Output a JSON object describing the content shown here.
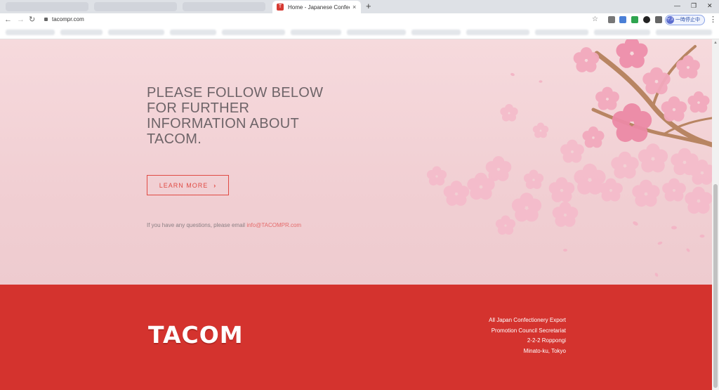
{
  "browser": {
    "active_tab_title": "Home - Japanese Confectionary",
    "tab_close": "×",
    "new_tab": "+",
    "url": "tacompr.com",
    "profile_label": "一時停止中",
    "profile_avatar": "ゲスト"
  },
  "hero": {
    "headline_lines": [
      "PLEASE FOLLOW BELOW",
      "FOR FURTHER",
      "INFORMATION ABOUT",
      "TACOM."
    ],
    "learn_more_label": "LEARN MORE",
    "learn_more_chevron": "›",
    "contact_text": "If you have any questions, please email ",
    "contact_email": "info@TACOMPR.com"
  },
  "footer": {
    "logo_text": "TACOM",
    "address_lines": [
      "All Japan Confectionery Export",
      "Promotion Council Secretariat",
      "2-2-2 Roppongi",
      "Minato-ku, Tokyo"
    ]
  },
  "colors": {
    "accent_red": "#d4332e",
    "button_red": "#e04b44",
    "hero_pink": "#f3d4d8",
    "blossom_pink": "#f2a9bd",
    "branch_brown": "#b88563"
  }
}
